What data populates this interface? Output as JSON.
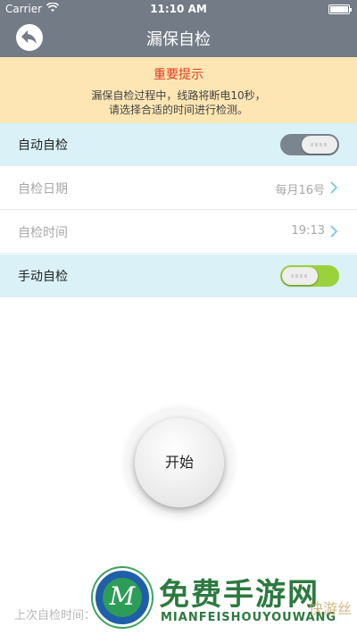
{
  "status_bar": {
    "carrier": "Carrier",
    "wifi_icon": "wifi-icon",
    "time": "11:10 AM",
    "battery_icon": "battery-icon"
  },
  "nav": {
    "title": "漏保自检",
    "back_icon": "back-arrow-icon"
  },
  "notice": {
    "heading": "重要提示",
    "line1": "漏保自检过程中，线路将断电10秒，",
    "line2": "请选择合适的时间进行检测。",
    "heading_color": "#e03b1e",
    "background": "#fde6b3"
  },
  "settings": {
    "auto_check": {
      "label": "自动自检",
      "enabled": false
    },
    "check_date": {
      "label": "自检日期",
      "value": "每月16号"
    },
    "check_time": {
      "label": "自检时间",
      "value": "19:13"
    },
    "manual_check": {
      "label": "手动自检",
      "enabled": true
    }
  },
  "start_button": {
    "label": "开始"
  },
  "footer": {
    "last_check_label": "上次自检时间："
  },
  "watermark": {
    "cn": "免费手游网",
    "en": "MIANFEISHOUYOUWANG",
    "side": "快游丝",
    "logo_letter": "M"
  },
  "colors": {
    "header": "#737b86",
    "row_highlight": "#d9f1f7",
    "toggle_on": "#9ad23b",
    "toggle_off": "#7b8590"
  }
}
